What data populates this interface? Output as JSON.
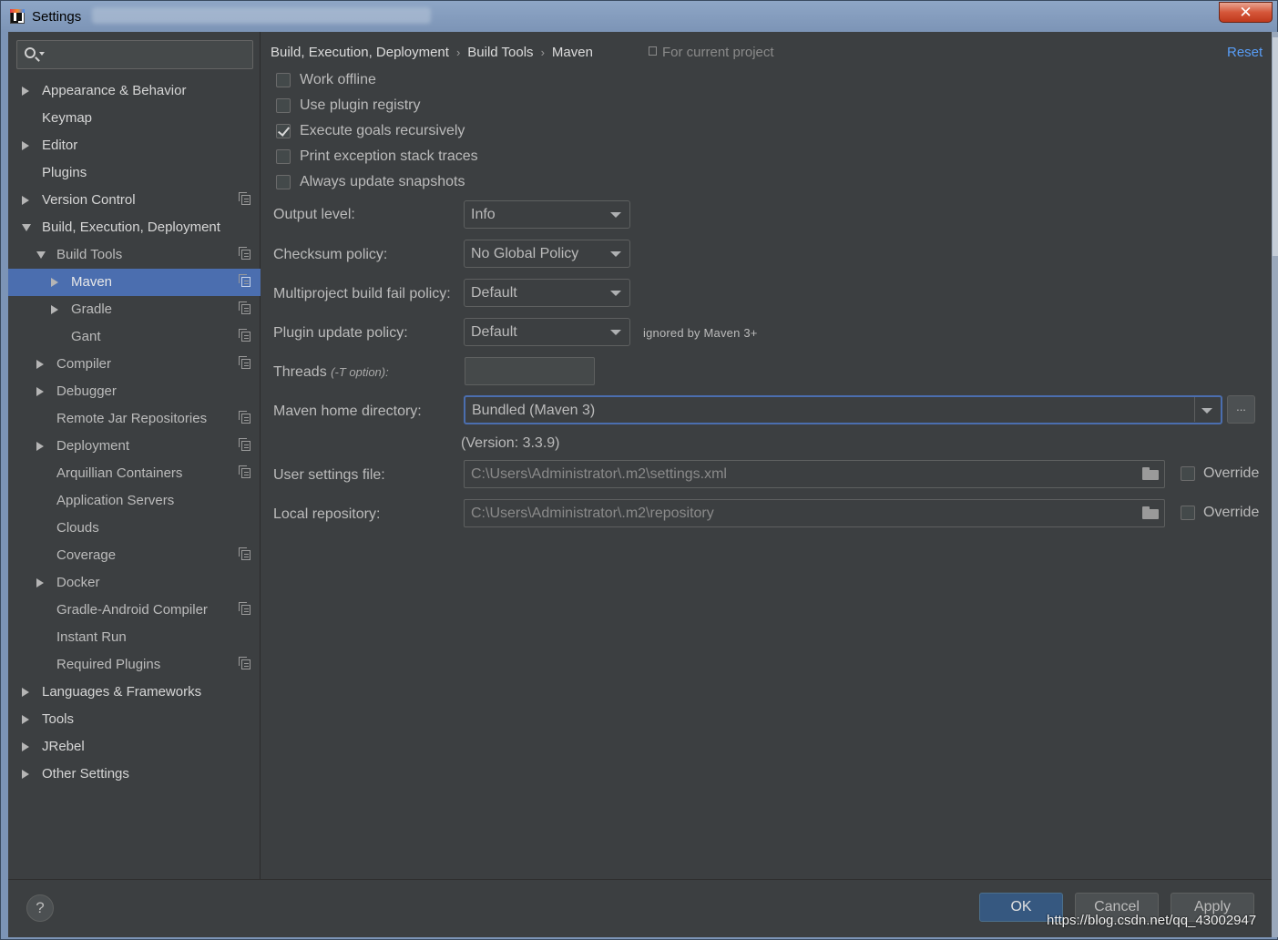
{
  "window": {
    "title": "Settings",
    "close_label": "✕"
  },
  "sidebar": {
    "search": {
      "placeholder": "",
      "value": ""
    },
    "items": [
      {
        "label": "Appearance & Behavior",
        "arrow": "collapsed",
        "level": 0,
        "copy": false,
        "selected": false
      },
      {
        "label": "Keymap",
        "arrow": "none",
        "level": 0,
        "copy": false,
        "selected": false
      },
      {
        "label": "Editor",
        "arrow": "collapsed",
        "level": 0,
        "copy": false,
        "selected": false
      },
      {
        "label": "Plugins",
        "arrow": "none",
        "level": 0,
        "copy": false,
        "selected": false
      },
      {
        "label": "Version Control",
        "arrow": "collapsed",
        "level": 0,
        "copy": true,
        "selected": false
      },
      {
        "label": "Build, Execution, Deployment",
        "arrow": "expanded",
        "level": 0,
        "copy": false,
        "selected": false
      },
      {
        "label": "Build Tools",
        "arrow": "expanded",
        "level": 1,
        "copy": true,
        "selected": false
      },
      {
        "label": "Maven",
        "arrow": "collapsed",
        "level": 2,
        "copy": true,
        "selected": true
      },
      {
        "label": "Gradle",
        "arrow": "collapsed",
        "level": 2,
        "copy": true,
        "selected": false
      },
      {
        "label": "Gant",
        "arrow": "none",
        "level": 2,
        "copy": true,
        "selected": false
      },
      {
        "label": "Compiler",
        "arrow": "collapsed",
        "level": 1,
        "copy": true,
        "selected": false
      },
      {
        "label": "Debugger",
        "arrow": "collapsed",
        "level": 1,
        "copy": false,
        "selected": false
      },
      {
        "label": "Remote Jar Repositories",
        "arrow": "none",
        "level": 1,
        "copy": true,
        "selected": false
      },
      {
        "label": "Deployment",
        "arrow": "collapsed",
        "level": 1,
        "copy": true,
        "selected": false
      },
      {
        "label": "Arquillian Containers",
        "arrow": "none",
        "level": 1,
        "copy": true,
        "selected": false
      },
      {
        "label": "Application Servers",
        "arrow": "none",
        "level": 1,
        "copy": false,
        "selected": false
      },
      {
        "label": "Clouds",
        "arrow": "none",
        "level": 1,
        "copy": false,
        "selected": false
      },
      {
        "label": "Coverage",
        "arrow": "none",
        "level": 1,
        "copy": true,
        "selected": false
      },
      {
        "label": "Docker",
        "arrow": "collapsed",
        "level": 1,
        "copy": false,
        "selected": false
      },
      {
        "label": "Gradle-Android Compiler",
        "arrow": "none",
        "level": 1,
        "copy": true,
        "selected": false
      },
      {
        "label": "Instant Run",
        "arrow": "none",
        "level": 1,
        "copy": false,
        "selected": false
      },
      {
        "label": "Required Plugins",
        "arrow": "none",
        "level": 1,
        "copy": true,
        "selected": false
      },
      {
        "label": "Languages & Frameworks",
        "arrow": "collapsed",
        "level": 0,
        "copy": false,
        "selected": false
      },
      {
        "label": "Tools",
        "arrow": "collapsed",
        "level": 0,
        "copy": false,
        "selected": false
      },
      {
        "label": "JRebel",
        "arrow": "collapsed",
        "level": 0,
        "copy": false,
        "selected": false
      },
      {
        "label": "Other Settings",
        "arrow": "collapsed",
        "level": 0,
        "copy": false,
        "selected": false
      }
    ]
  },
  "header": {
    "breadcrumb": [
      "Build, Execution, Deployment",
      "Build Tools",
      "Maven"
    ],
    "separator": "›",
    "project_note": "For current project",
    "reset_label": "Reset"
  },
  "options": {
    "checkboxes": [
      {
        "label": "Work offline",
        "checked": false
      },
      {
        "label": "Use plugin registry",
        "checked": false
      },
      {
        "label": "Execute goals recursively",
        "checked": true
      },
      {
        "label": "Print exception stack traces",
        "checked": false
      },
      {
        "label": "Always update snapshots",
        "checked": false
      }
    ],
    "output_level": {
      "label": "Output level:",
      "value": "Info"
    },
    "checksum_policy": {
      "label": "Checksum policy:",
      "value": "No Global Policy"
    },
    "multiproject_fail_policy": {
      "label": "Multiproject build fail policy:",
      "value": "Default"
    },
    "plugin_update_policy": {
      "label": "Plugin update policy:",
      "value": "Default",
      "note": "ignored by Maven 3+"
    },
    "threads": {
      "label": "Threads",
      "hint": "(-T option):",
      "value": ""
    },
    "maven_home": {
      "label": "Maven home directory:",
      "value": "Bundled (Maven 3)",
      "browse_label": "...",
      "version": "(Version: 3.3.9)"
    },
    "user_settings": {
      "label": "User settings file:",
      "value": "C:\\Users\\Administrator\\.m2\\settings.xml",
      "override_label": "Override",
      "override_checked": false
    },
    "local_repository": {
      "label": "Local repository:",
      "value": "C:\\Users\\Administrator\\.m2\\repository",
      "override_label": "Override",
      "override_checked": false
    }
  },
  "footer": {
    "help_label": "?",
    "ok_label": "OK",
    "cancel_label": "Cancel",
    "apply_label": "Apply"
  },
  "watermark": "https://blog.csdn.net/qq_43002947"
}
